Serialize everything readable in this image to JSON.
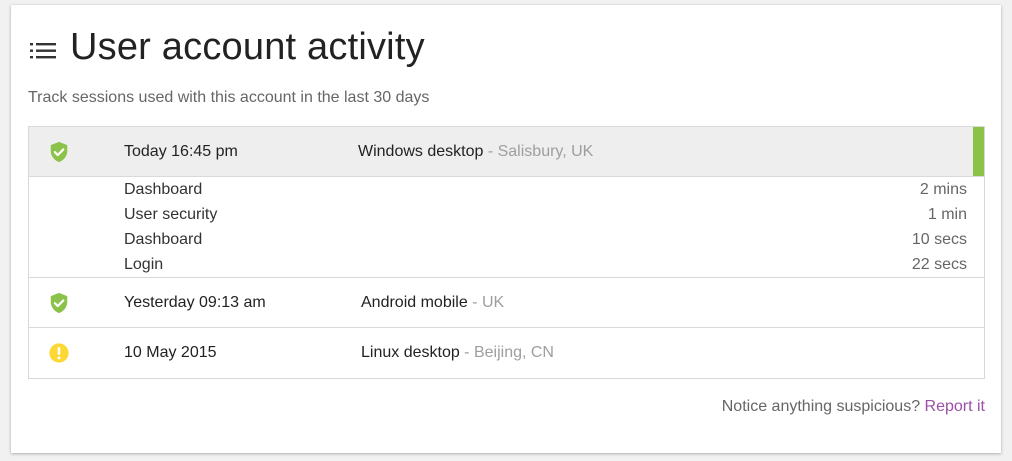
{
  "header": {
    "title": "User account activity",
    "subtitle": "Track sessions used with this account in the last 30 days",
    "icon": "list-icon"
  },
  "colors": {
    "accent_active": "#8bc34a",
    "status_ok": "#8bc34a",
    "status_warning": "#fdd835",
    "link": "#9c4fa8"
  },
  "sessions": [
    {
      "status": "ok",
      "status_icon": "shield-check-icon",
      "time": "Today 16:45 pm",
      "device": "Windows desktop",
      "location": " - Salisbury, UK",
      "expanded": true,
      "activity": [
        {
          "page": "Dashboard",
          "duration": "2 mins"
        },
        {
          "page": "User security",
          "duration": "1 min"
        },
        {
          "page": "Dashboard",
          "duration": "10 secs"
        },
        {
          "page": "Login",
          "duration": "22 secs"
        }
      ]
    },
    {
      "status": "ok",
      "status_icon": "shield-check-icon",
      "time": "Yesterday 09:13 am",
      "device": "Android mobile",
      "location": " - UK",
      "expanded": false
    },
    {
      "status": "warning",
      "status_icon": "warning-circle-icon",
      "time": "10 May 2015",
      "device": "Linux desktop",
      "location": " - Beijing, CN",
      "expanded": false
    }
  ],
  "footer": {
    "text": "Notice anything suspicious? ",
    "link_label": "Report it"
  }
}
